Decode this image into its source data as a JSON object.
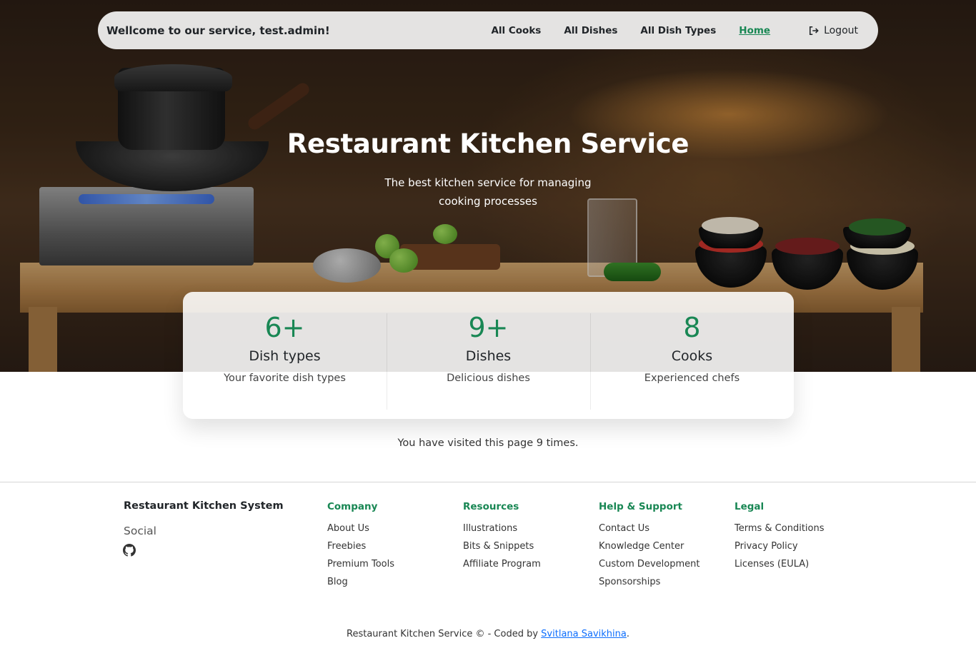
{
  "nav": {
    "brand": "Wellcome to our service, test.admin!",
    "links": [
      "All Cooks",
      "All Dishes",
      "All Dish Types",
      "Home"
    ],
    "logout": "Logout"
  },
  "hero": {
    "title": "Restaurant Kitchen Service",
    "subtitle": "The best kitchen service for managing cooking processes"
  },
  "stats": [
    {
      "value": "6+",
      "title": "Dish types",
      "desc": "Your favorite dish types"
    },
    {
      "value": "9+",
      "title": "Dishes",
      "desc": "Delicious dishes"
    },
    {
      "value": "8",
      "title": "Cooks",
      "desc": "Experienced chefs"
    }
  ],
  "visits": "You have visited this page 9 times.",
  "footer": {
    "brand": "Restaurant Kitchen System",
    "social": "Social",
    "columns": [
      {
        "title": "Company",
        "items": [
          "About Us",
          "Freebies",
          "Premium Tools",
          "Blog"
        ]
      },
      {
        "title": "Resources",
        "items": [
          "Illustrations",
          "Bits & Snippets",
          "Affiliate Program"
        ]
      },
      {
        "title": "Help & Support",
        "items": [
          "Contact Us",
          "Knowledge Center",
          "Custom Development",
          "Sponsorships"
        ]
      },
      {
        "title": "Legal",
        "items": [
          "Terms & Conditions",
          "Privacy Policy",
          "Licenses (EULA)"
        ]
      }
    ],
    "copyright_prefix": "Restaurant Kitchen Service © - Coded by ",
    "author": "Svitlana Savikhina",
    "copyright_suffix": "."
  },
  "colors": {
    "accent": "#198754",
    "link": "#0d6efd"
  }
}
